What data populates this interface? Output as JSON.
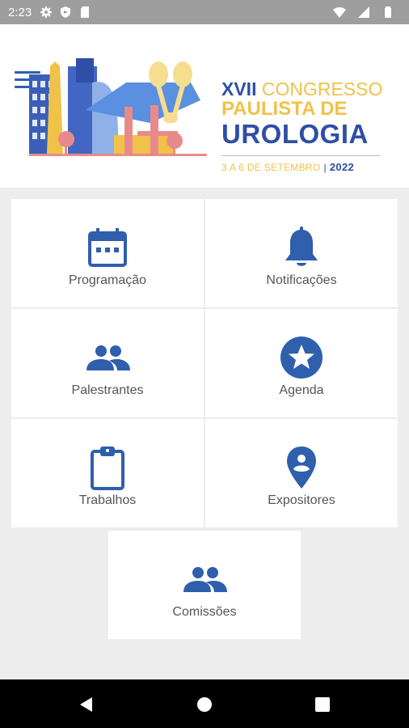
{
  "status_bar": {
    "time": "2:23",
    "left_icons": [
      "gear-icon",
      "shield-icon",
      "sd-card-icon"
    ],
    "right_icons": [
      "wifi-icon",
      "signal-icon",
      "battery-icon"
    ]
  },
  "header": {
    "logo": {
      "line1_a": "XVII",
      "line1_b": " CONGRESSO",
      "line2": "PAULISTA DE",
      "line3": "UROLOGIA",
      "dates": "3 A 6 DE SETEMBRO",
      "separator": "|",
      "year": "2022"
    },
    "menu_icon": "hamburger-icon"
  },
  "menu": {
    "items": [
      {
        "label": "Programação",
        "icon": "calendar-icon"
      },
      {
        "label": "Notificações",
        "icon": "bell-icon"
      },
      {
        "label": "Palestrantes",
        "icon": "people-icon"
      },
      {
        "label": "Agenda",
        "icon": "star-circle-icon"
      },
      {
        "label": "Trabalhos",
        "icon": "clipboard-icon"
      },
      {
        "label": "Expositores",
        "icon": "map-pin-icon"
      },
      {
        "label": "Comissões",
        "icon": "people-icon"
      }
    ]
  },
  "colors": {
    "primary": "#2f5fad",
    "accent_yellow": "#f0c24a",
    "background": "#ededed",
    "status_bar": "#9e9e9e"
  },
  "nav_bar": {
    "buttons": [
      "back-icon",
      "home-icon",
      "recents-icon"
    ]
  }
}
